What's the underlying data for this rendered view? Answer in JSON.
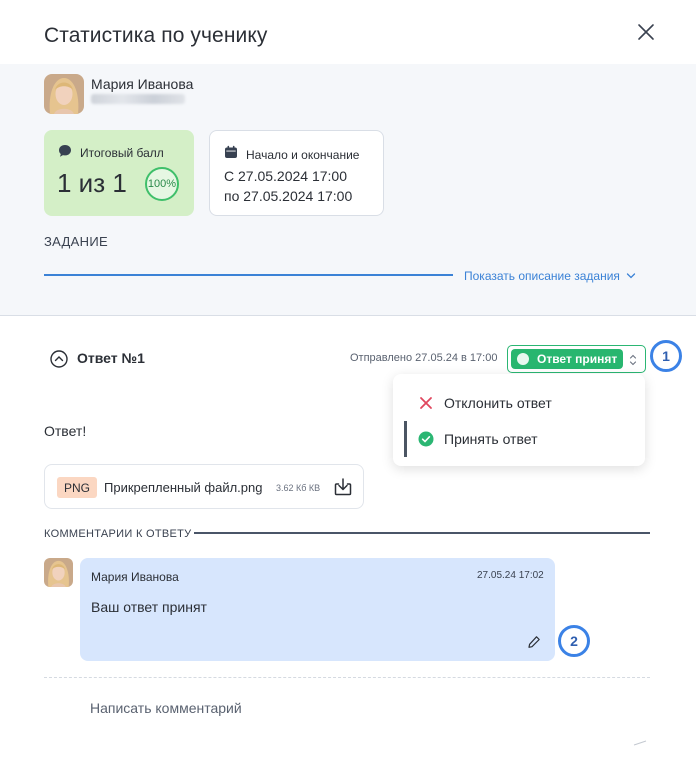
{
  "dialog": {
    "title": "Статистика по ученику"
  },
  "student": {
    "name": "Мария Иванова"
  },
  "score_card": {
    "label": "Итоговый балл",
    "value": "1 из 1",
    "percent": "100%"
  },
  "date_card": {
    "label": "Начало и окончание",
    "from": "С 27.05.2024 17:00",
    "to": "по 27.05.2024 17:00"
  },
  "task": {
    "heading": "ЗАДАНИЕ",
    "toggle_label": "Показать описание задания"
  },
  "answer": {
    "title": "Ответ №1",
    "sent_at": "Отправлено 27.05.24 в 17:00",
    "status": "Ответ принят",
    "text": "Ответ!",
    "status_color": "#28b66f"
  },
  "status_menu": {
    "items": [
      {
        "label": "Отклонить ответ",
        "icon": "close-icon",
        "color": "#e0475e"
      },
      {
        "label": "Принять ответ",
        "icon": "check-circle-icon",
        "color": "#2bb673"
      }
    ]
  },
  "attachment": {
    "ext": "PNG",
    "name": "Прикрепленный файл.png",
    "size": "3.62 Кб КВ"
  },
  "comments": {
    "heading": "КОММЕНТАРИИ К ОТВЕТУ",
    "items": [
      {
        "author": "Мария Иванова",
        "date": "27.05.24 17:02",
        "text": "Ваш ответ принят"
      }
    ],
    "input_placeholder": "Написать комментарий"
  },
  "callouts": [
    "1",
    "2"
  ],
  "colors": {
    "accent": "#3b82d6",
    "score_bg": "#d4efc7",
    "comment_bg": "#d7e6fd",
    "file_badge_bg": "#fbd7c2"
  }
}
